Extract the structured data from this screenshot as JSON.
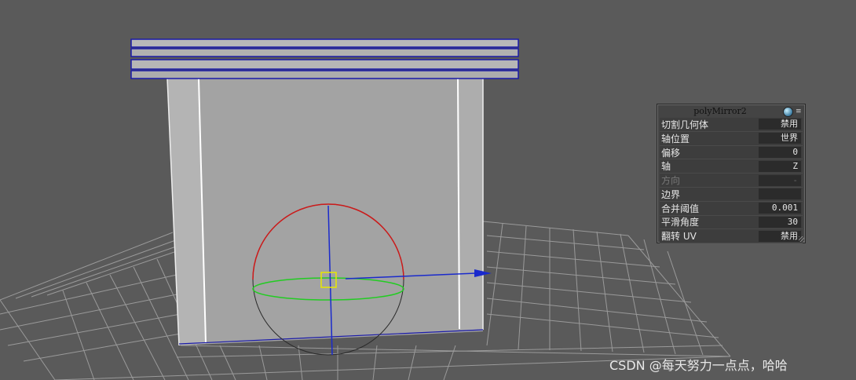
{
  "panel": {
    "title": "polyMirror2",
    "rows": [
      {
        "label": "切割几何体",
        "value": "禁用",
        "dim": false
      },
      {
        "label": "轴位置",
        "value": "世界",
        "dim": false
      },
      {
        "label": "偏移",
        "value": "0",
        "dim": false
      },
      {
        "label": "轴",
        "value": "Z",
        "dim": false
      },
      {
        "label": "方向",
        "value": "-",
        "dim": true
      },
      {
        "label": "边界",
        "value": "",
        "dim": false
      },
      {
        "label": "合并阈值",
        "value": "0.001",
        "dim": false
      },
      {
        "label": "平滑角度",
        "value": "30",
        "dim": false
      },
      {
        "label": "翻转 UV",
        "value": "禁用",
        "dim": false
      }
    ]
  },
  "watermark": "CSDN @每天努力一点点，哈哈",
  "colors": {
    "background": "#5a5a5a",
    "grid": "#9a9a9a",
    "mesh": "#a3a3a3",
    "wireframe": "#1a1aa8",
    "gizmo_x": "#cc1a1a",
    "gizmo_y": "#22cc22",
    "gizmo_z": "#1a2acc",
    "pivot": "#e8e800"
  }
}
